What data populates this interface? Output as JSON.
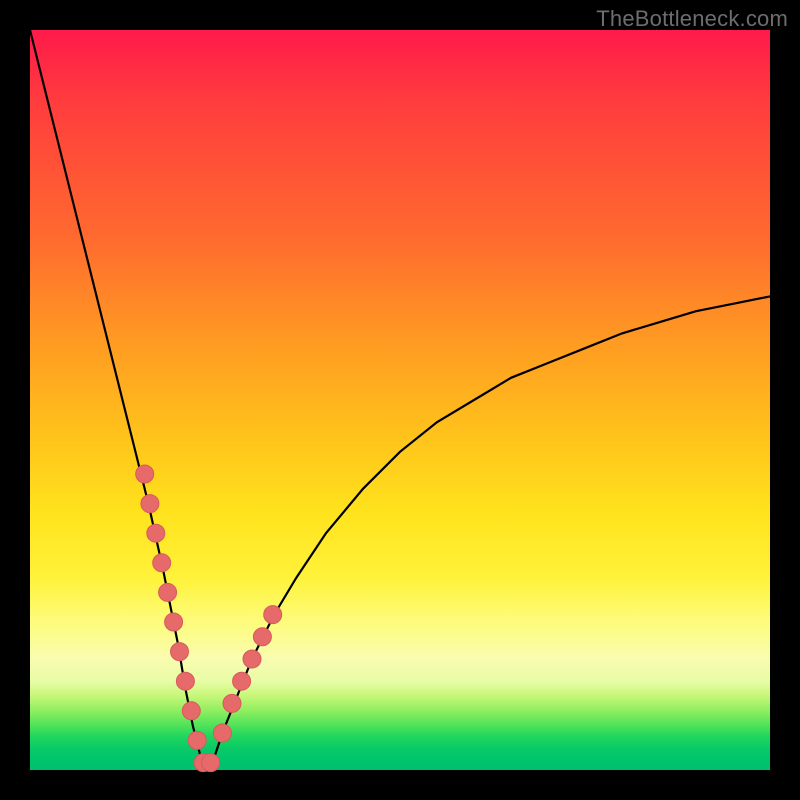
{
  "watermark": "TheBottleneck.com",
  "colors": {
    "frame": "#000000",
    "curve": "#000000",
    "marker_fill": "#e66a6a",
    "marker_stroke": "#d85a5a",
    "gradient_top": "#ff1a4b",
    "gradient_bottom": "#00c070"
  },
  "chart_data": {
    "type": "line",
    "title": "",
    "xlabel": "",
    "ylabel": "",
    "xlim": [
      0,
      100
    ],
    "ylim": [
      0,
      100
    ],
    "note": "V-shaped bottleneck curve. y ≈ 100 at x=0, drops to ~0 near x≈23, rises toward ~64 at x=100. Markers cluster on lower limbs of the V.",
    "series": [
      {
        "name": "bottleneck-curve",
        "x": [
          0,
          2,
          4,
          6,
          8,
          10,
          12,
          14,
          16,
          18,
          20,
          21,
          22,
          23,
          24,
          25,
          26,
          28,
          30,
          33,
          36,
          40,
          45,
          50,
          55,
          60,
          65,
          70,
          75,
          80,
          85,
          90,
          95,
          100
        ],
        "y": [
          100,
          92,
          84,
          76,
          68,
          60,
          52,
          44,
          36,
          27,
          17,
          11,
          6,
          2,
          0,
          2,
          5,
          10,
          15,
          21,
          26,
          32,
          38,
          43,
          47,
          50,
          53,
          55,
          57,
          59,
          60.5,
          62,
          63,
          64
        ]
      }
    ],
    "markers": {
      "name": "sample-points",
      "x": [
        15.5,
        16.2,
        17.0,
        17.8,
        18.6,
        19.4,
        20.2,
        21.0,
        21.8,
        22.6,
        23.4,
        24.4,
        26.0,
        27.3,
        28.6,
        30.0,
        31.4,
        32.8
      ],
      "y": [
        40,
        36,
        32,
        28,
        24,
        20,
        16,
        12,
        8,
        4,
        1,
        1,
        5,
        9,
        12,
        15,
        18,
        21
      ]
    }
  }
}
